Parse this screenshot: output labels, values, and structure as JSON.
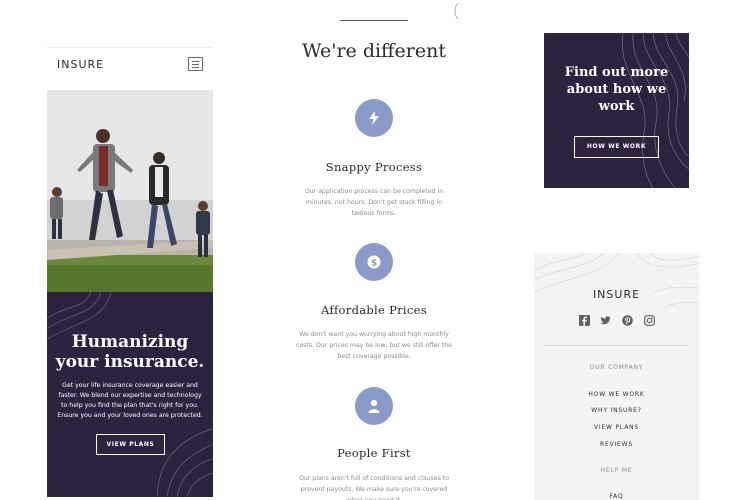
{
  "colors": {
    "dark_purple": "#2c2340",
    "accent_blue": "#8a9ac9",
    "muted_text": "#8c8a93",
    "footer_bg": "#f4f4f5"
  },
  "brand": {
    "logo": "INSURE"
  },
  "header": {
    "menu_icon": "hamburger-menu-icon"
  },
  "hero": {
    "image_alt": "family-walking-photo",
    "title_line1": "Humanizing",
    "title_line2": "your insurance.",
    "text": "Get your life insurance coverage easier and faster. We blend our expertise and technology to help you find the plan that's right for you. Ensure you and your loved ones are protected.",
    "button": "VIEW PLANS"
  },
  "different": {
    "title": "We're different",
    "features": [
      {
        "icon": "lightning-bolt-icon",
        "title": "Snappy Process",
        "text": "Our application process can be completed in minutes, not hours. Don't get stuck filling in tedious forms."
      },
      {
        "icon": "dollar-coin-icon",
        "title": "Affordable Prices",
        "text": "We don't want you worrying about high monthly costs. Our prices may be low, but we still offer the best coverage possible."
      },
      {
        "icon": "person-icon",
        "title": "People First",
        "text": "Our plans aren't full of conditions and clauses to prevent payouts. We make sure you're covered when you need it."
      }
    ]
  },
  "cta": {
    "title_line1": "Find out more",
    "title_line2": "about how we",
    "title_line3": "work",
    "button": "HOW WE WORK"
  },
  "footer": {
    "socials": [
      "facebook-icon",
      "twitter-icon",
      "pinterest-icon",
      "instagram-icon"
    ],
    "company_heading": "OUR COMPANY",
    "company_links": [
      "HOW WE WORK",
      "WHY INSURE?",
      "VIEW PLANS",
      "REVIEWS"
    ],
    "help_heading": "HELP ME",
    "help_links": [
      "FAQ"
    ]
  }
}
